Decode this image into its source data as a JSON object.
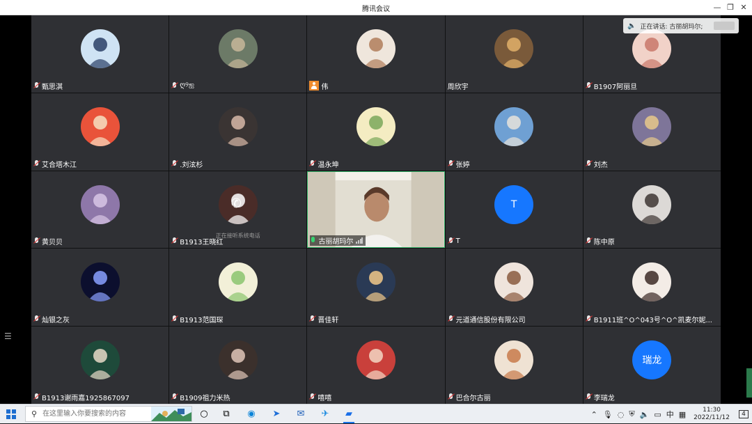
{
  "window": {
    "title": "腾讯会议"
  },
  "speaking": {
    "label": "正在讲话: 古丽胡玛尔;"
  },
  "participants": [
    {
      "name": "甄思淇",
      "mic": "muted",
      "avatar": "photo",
      "bg": "#cfe3f4",
      "fg": "#2a3f66"
    },
    {
      "name": "ღ୨ஐ",
      "mic": "muted",
      "avatar": "photo",
      "bg": "#6c7a67",
      "fg": "#c8b79a"
    },
    {
      "name": "伟",
      "mic": "user",
      "avatar": "photo",
      "bg": "#efe6dc",
      "fg": "#b07c5a"
    },
    {
      "name": "周欣宇",
      "mic": "none",
      "avatar": "photo",
      "bg": "#7a5a3a",
      "fg": "#e2b06a"
    },
    {
      "name": "B1907阿丽旦",
      "mic": "muted",
      "avatar": "photo",
      "bg": "#f1d2c8",
      "fg": "#c9786a"
    },
    {
      "name": "艾合塔木江",
      "mic": "muted",
      "avatar": "photo",
      "bg": "#e9533a",
      "fg": "#f6e0c2"
    },
    {
      "name": ".刘泫杉",
      "mic": "muted",
      "avatar": "photo",
      "bg": "#3a3433",
      "fg": "#d7b9a8"
    },
    {
      "name": "温永坤",
      "mic": "muted",
      "avatar": "photo",
      "bg": "#f4ecc2",
      "fg": "#7aa85a"
    },
    {
      "name": "张婷",
      "mic": "muted",
      "avatar": "photo",
      "bg": "#6fa0d3",
      "fg": "#e8e3da"
    },
    {
      "name": "刘杰",
      "mic": "muted",
      "avatar": "photo",
      "bg": "#7e7599",
      "fg": "#e7c98a"
    },
    {
      "name": "黄贝贝",
      "mic": "muted",
      "avatar": "photo",
      "bg": "#8e77a9",
      "fg": "#d8c6e6"
    },
    {
      "name": "B1913王晓红",
      "mic": "muted",
      "avatar": "phone",
      "bg": "#4a2c28",
      "fg": "#ffffff",
      "hint": "正在接听系统电话"
    },
    {
      "name": "古丽胡玛尔",
      "mic": "on",
      "avatar": "video",
      "bg": "#d6d3c8",
      "fg": "#ffffff"
    },
    {
      "name": "T",
      "mic": "muted",
      "avatar": "letter",
      "letter": "T",
      "bg": "#1677ff",
      "fg": "#ffffff"
    },
    {
      "name": "陈中原",
      "mic": "muted",
      "avatar": "photo",
      "bg": "#dcd9d6",
      "fg": "#3d3532"
    },
    {
      "name": "灿银之灰",
      "mic": "muted",
      "avatar": "photo",
      "bg": "#0c0f2e",
      "fg": "#8aa0ff"
    },
    {
      "name": "B1913范国琛",
      "mic": "muted",
      "avatar": "photo",
      "bg": "#f2f0d8",
      "fg": "#8bc46e"
    },
    {
      "name": "晋佳轩",
      "mic": "muted",
      "avatar": "photo",
      "bg": "#2a3a55",
      "fg": "#f2c98a"
    },
    {
      "name": "元道通信股份有限公司",
      "mic": "muted",
      "avatar": "photo",
      "bg": "#efe4dc",
      "fg": "#8a5a3e"
    },
    {
      "name": "B1911班^O^043号^O^凯麦尔妮...",
      "mic": "muted",
      "avatar": "photo",
      "bg": "#f3ece6",
      "fg": "#3b2a25"
    },
    {
      "name": "B1913谢雨嘉1925867097",
      "mic": "muted",
      "avatar": "photo",
      "bg": "#1e4a3a",
      "fg": "#e8d9c8"
    },
    {
      "name": "B1909祖力米热",
      "mic": "muted",
      "avatar": "photo",
      "bg": "#3b302c",
      "fg": "#e0c6b8"
    },
    {
      "name": "嘻嘻",
      "mic": "muted",
      "avatar": "photo",
      "bg": "#c9403b",
      "fg": "#f3d7c4"
    },
    {
      "name": "巴合尔古丽",
      "mic": "muted",
      "avatar": "photo",
      "bg": "#efe2d3",
      "fg": "#c87a4a"
    },
    {
      "name": "李瑞龙",
      "mic": "muted",
      "avatar": "letter",
      "letter": "瑞龙",
      "bg": "#1677ff",
      "fg": "#ffffff"
    }
  ],
  "taskbar": {
    "search_placeholder": "在这里输入你要搜索的内容",
    "ime": "中",
    "time": "11:30",
    "date": "2022/11/12",
    "notification_count": "4"
  }
}
